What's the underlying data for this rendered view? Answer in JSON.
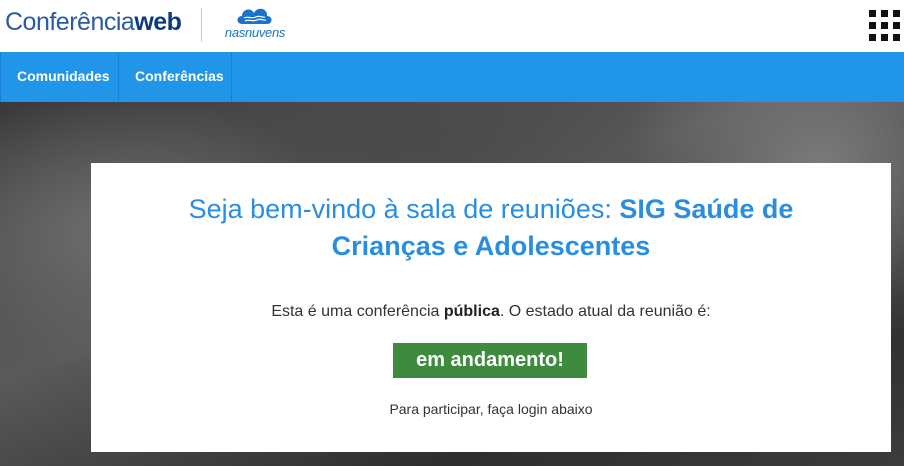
{
  "header": {
    "logo_light": "Conferência",
    "logo_bold": "web",
    "partner_logo": "nasnuvens",
    "menu_icon": "grid-icon"
  },
  "nav": {
    "items": [
      {
        "label": "Comunidades"
      },
      {
        "label": "Conferências"
      }
    ]
  },
  "card": {
    "title_prefix": "Seja bem-vindo à sala de reuniões: ",
    "title_room": "SIG Saúde de Crianças e Adolescentes",
    "status_text_1": "Esta é uma conferência ",
    "status_public": "pública",
    "status_text_2": ". O estado atual da reunião é:",
    "status_badge": "em andamento!",
    "hint": "Para participar, faça login abaixo"
  },
  "colors": {
    "nav_bg": "#2196e8",
    "title": "#2a8ee0",
    "badge_bg": "#3e8a3e"
  }
}
